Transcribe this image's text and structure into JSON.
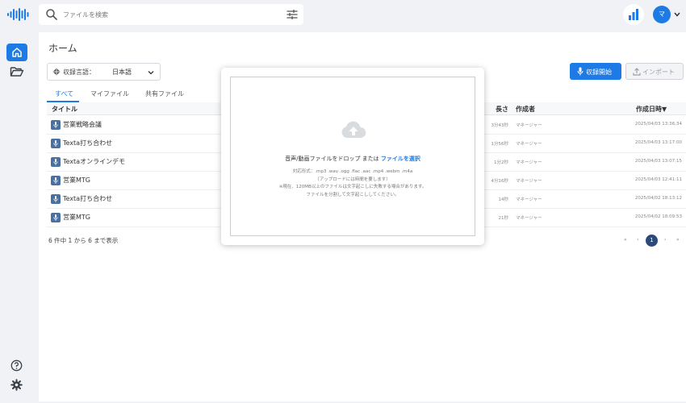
{
  "search": {
    "placeholder": "ファイルを検索"
  },
  "user": {
    "avatar_initial": "マ"
  },
  "main": {
    "title": "ホーム",
    "language": {
      "label": "収録言語：",
      "value": "日本語"
    },
    "buttons": {
      "record": "収録開始",
      "import": "インポート"
    },
    "tabs": [
      "すべて",
      "マイファイル",
      "共有ファイル"
    ],
    "columns": {
      "title": "タイトル",
      "length": "長さ",
      "author": "作成者",
      "created": "作成日時▼"
    },
    "rows": [
      {
        "title": "営業戦略会議",
        "length": "3分43秒",
        "author": "マネージャー",
        "created": "2025/04/03 13:36:34"
      },
      {
        "title": "Texta打ち合わせ",
        "length": "1分56秒",
        "author": "マネージャー",
        "created": "2025/04/03 13:17:00"
      },
      {
        "title": "Textaオンラインデモ",
        "length": "1分2秒",
        "author": "マネージャー",
        "created": "2025/04/03 13:07:15"
      },
      {
        "title": "営業MTG",
        "length": "4分16秒",
        "author": "マネージャー",
        "created": "2025/04/03 12:41:11"
      },
      {
        "title": "Texta打ち合わせ",
        "length": "14秒",
        "author": "マネージャー",
        "created": "2025/04/02 18:13:12"
      },
      {
        "title": "営業MTG",
        "length": "21秒",
        "author": "マネージャー",
        "created": "2025/04/02 18:09:53"
      }
    ],
    "footer": "6 件中 1 から 6 まで表示",
    "pagination": {
      "first": "«",
      "prev": "‹",
      "current": "1",
      "next": "›",
      "last": "»"
    }
  },
  "modal": {
    "drop_text": "音声/動画ファイルをドロップ または ",
    "select_link": "ファイルを選択",
    "formats": "対応形式：.mp3 .wav .ogg .flac .aac .mp4 .webm .m4a",
    "upload_note": "（アップロードには時間を要します）",
    "size_warning": "※現在、120MB以上のファイルは文字起こしに失敗する場合があります。",
    "split_note": "ファイルを分割して文字起こししてください。"
  },
  "icons": {
    "logo": "waveform-logo",
    "search": "search-icon",
    "filter": "sliders-icon",
    "chart": "bar-chart-icon",
    "home": "home-icon",
    "folder": "folder-open-icon",
    "help": "help-icon",
    "settings": "gear-icon",
    "upload": "cloud-upload-icon",
    "mic": "mic-icon",
    "file": "audio-file-icon"
  },
  "colors": {
    "accent": "#1e7be5",
    "pager_active": "#2b4a78",
    "file_icon": "#4a6fa1"
  }
}
